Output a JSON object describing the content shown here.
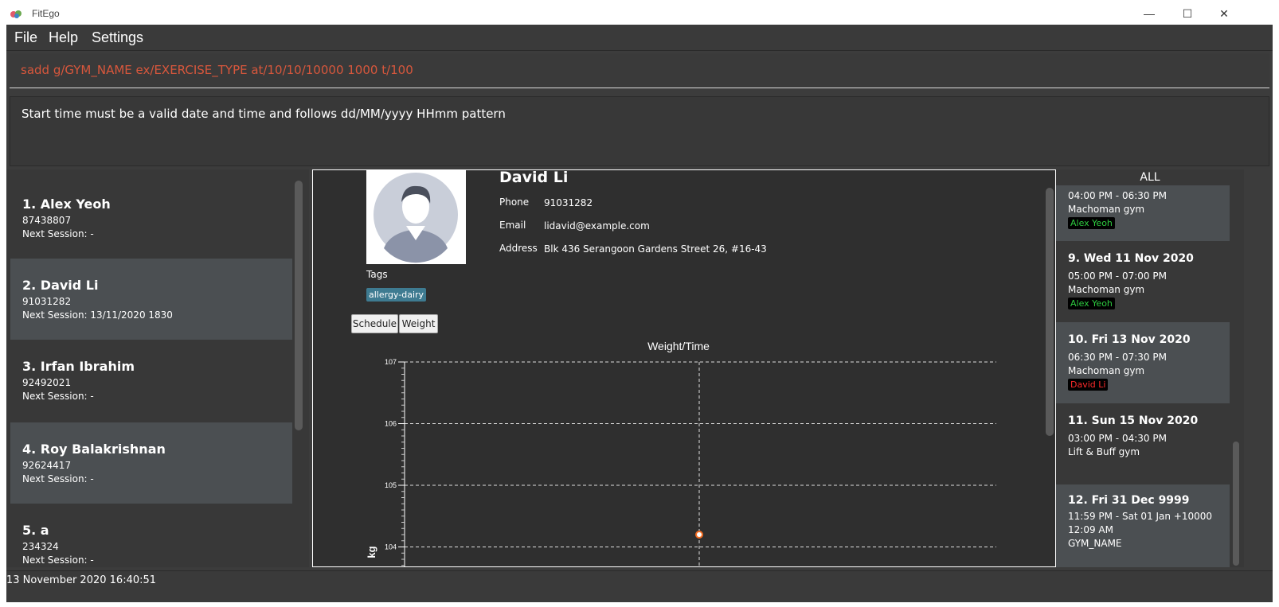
{
  "window": {
    "title": "FitEgo",
    "controls": {
      "minimize": "—",
      "maximize": "☐",
      "close": "✕"
    }
  },
  "menu": {
    "file": "File",
    "help": "Help",
    "settings": "Settings"
  },
  "command": {
    "value": "sadd g/GYM_NAME ex/EXERCISE_TYPE at/10/10/10000 1000 t/100"
  },
  "result": {
    "message": "Start time must be a valid date and time and follows dd/MM/yyyy HHmm pattern"
  },
  "clients": [
    {
      "name": "1.  Alex Yeoh",
      "phone": "87438807",
      "next": "Next Session:  -"
    },
    {
      "name": "2.  David Li",
      "phone": "91031282",
      "next": "Next Session: 13/11/2020 1830"
    },
    {
      "name": "3.  Irfan Ibrahim",
      "phone": "92492021",
      "next": "Next Session:  -"
    },
    {
      "name": "4.  Roy Balakrishnan",
      "phone": "92624417",
      "next": "Next Session:  -"
    },
    {
      "name": "5.  a",
      "phone": "234324",
      "next": "Next Session:  -"
    }
  ],
  "detail": {
    "name": "David Li",
    "phone_label": "Phone",
    "phone": "91031282",
    "email_label": "Email",
    "email": "lidavid@example.com",
    "address_label": "Address",
    "address": "Blk 436 Serangoon Gardens Street 26, #16-43",
    "tags_label": "Tags",
    "tag": "allergy-dairy",
    "tab_schedule": "Schedule",
    "tab_weight": "Weight"
  },
  "chart_data": {
    "type": "line",
    "title": "Weight/Time",
    "ylabel": "kg",
    "xlabel": "",
    "ylim": [
      103.7,
      107
    ],
    "yticks": [
      "107",
      "106",
      "105",
      "104"
    ],
    "grid": true,
    "series": [
      {
        "values": [
          104.2
        ]
      }
    ]
  },
  "sessions": {
    "header": "ALL",
    "items": [
      {
        "title": "",
        "time": "04:00 PM - 06:30 PM",
        "gym": "Machoman gym",
        "client": "Alex Yeoh",
        "client_color": "#2ecc40"
      },
      {
        "title": "9.  Wed 11 Nov 2020",
        "time": "05:00 PM - 07:00 PM",
        "gym": "Machoman gym",
        "client": "Alex Yeoh",
        "client_color": "#2ecc40"
      },
      {
        "title": "10.  Fri 13 Nov 2020",
        "time": "06:30 PM - 07:30 PM",
        "gym": "Machoman gym",
        "client": "David Li",
        "client_color": "#ff2b2b"
      },
      {
        "title": "11.  Sun 15 Nov 2020",
        "time": "03:00 PM - 04:30 PM",
        "gym": "Lift & Buff gym",
        "client": "",
        "client_color": ""
      },
      {
        "title": "12.  Fri 31 Dec 9999",
        "time": "11:59 PM - Sat 01 Jan +10000",
        "time2": "12:09 AM",
        "gym": "GYM_NAME",
        "client": "",
        "client_color": ""
      }
    ]
  },
  "status": {
    "text": "13 November 2020 16:40:51"
  }
}
